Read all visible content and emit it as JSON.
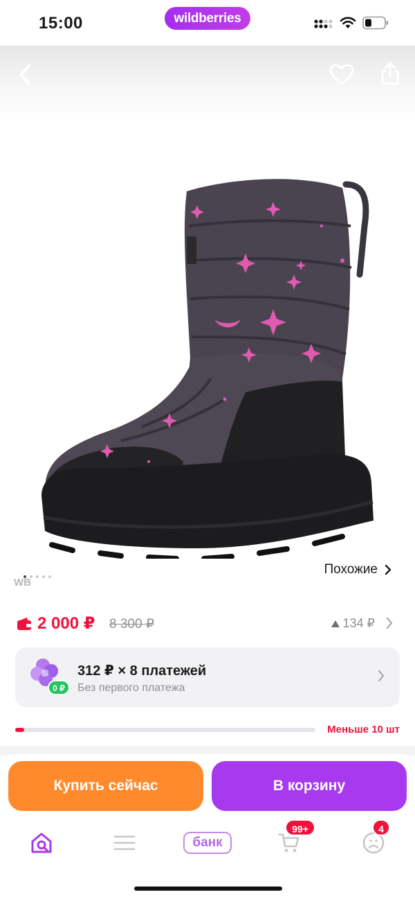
{
  "status_bar": {
    "time": "15:00",
    "brand": "wildberries",
    "icons": [
      "cellular-signal-icon",
      "wifi-icon",
      "battery-icon"
    ]
  },
  "product": {
    "image_alt": "Детский зимний сапог",
    "image_colors": {
      "upper": "#4a4450",
      "sole": "#1c1c1e",
      "stars": "#e05bb0"
    },
    "gallery": {
      "watermark": "WB",
      "slide_count": 5,
      "active_slide": 1
    },
    "similar_label": "Похожие"
  },
  "price": {
    "current": "2 000 ₽",
    "old": "8 300 ₽",
    "delta": "134 ₽"
  },
  "installment": {
    "title": "312 ₽ × 8 платежей",
    "subtitle": "Без первого платежа",
    "badge": "0 ₽"
  },
  "stock": {
    "level": 0.03,
    "label": "Меньше 10 шт"
  },
  "actions": {
    "buy_now": "Купить сейчас",
    "add_to_cart": "В корзину"
  },
  "tabbar": {
    "bank_label": "банк",
    "cart_badge": "99+",
    "profile_badge": "4"
  },
  "colors": {
    "accent_purple": "#a73aee",
    "buy_orange": "#ff8a2d",
    "price_red": "#f0123c",
    "muted": "#8e8e93"
  }
}
